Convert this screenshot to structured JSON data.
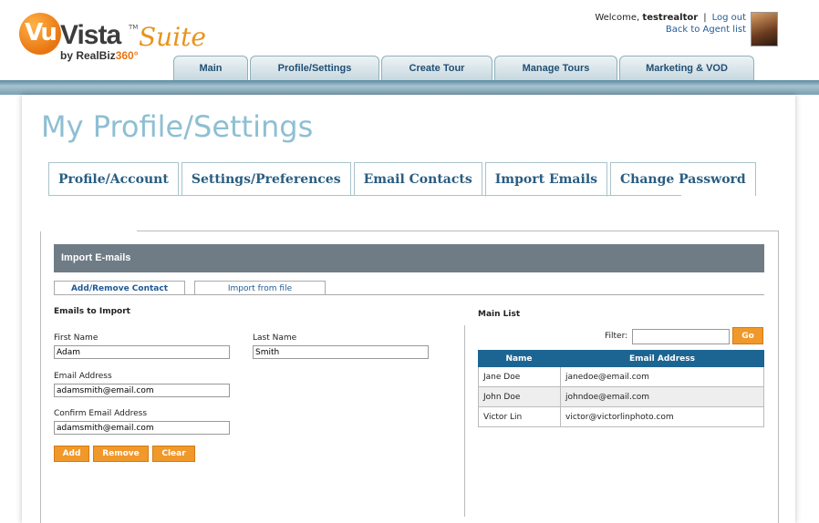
{
  "logo": {
    "mark": "Vu",
    "name": "Vista",
    "tm": "TM",
    "suite": "Suite",
    "by": "by RealBiz",
    "by_num": "360",
    "by_degree": "°"
  },
  "header": {
    "welcome_prefix": "Welcome,",
    "username": "testrealtor",
    "separator": "|",
    "logout": "Log out",
    "back_link": "Back to Agent list"
  },
  "top_nav": [
    "Main",
    "Profile/Settings",
    "Create Tour",
    "Manage Tours",
    "Marketing & VOD"
  ],
  "page_title": "My Profile/Settings",
  "sub_tabs": [
    "Profile/Account",
    "Settings/Preferences",
    "Email Contacts",
    "Import Emails",
    "Change Password"
  ],
  "active_sub_tab": "Import Emails",
  "panel": {
    "heading": "Import E-mails",
    "inner_tabs": [
      "Add/Remove Contact",
      "Import from file"
    ],
    "form": {
      "section_title": "Emails to Import",
      "first_name_label": "First Name",
      "first_name_value": "Adam",
      "last_name_label": "Last Name",
      "last_name_value": "Smith",
      "email_label": "Email Address",
      "email_value": "adamsmith@email.com",
      "confirm_label": "Confirm Email Address",
      "confirm_value": "adamsmith@email.com",
      "buttons": {
        "add": "Add",
        "remove": "Remove",
        "clear": "Clear"
      }
    },
    "main_list": {
      "title": "Main List",
      "filter_label": "Filter:",
      "filter_value": "",
      "go": "Go",
      "columns": [
        "Name",
        "Email Address"
      ],
      "rows": [
        {
          "name": "Jane Doe",
          "email": "janedoe@email.com"
        },
        {
          "name": "John Doe",
          "email": "johndoe@email.com"
        },
        {
          "name": "Victor Lin",
          "email": "victor@victorlinphoto.com"
        }
      ]
    }
  },
  "colors": {
    "accent_orange": "#f0982a",
    "table_header": "#1c6592",
    "title_blue": "#8ebfd3",
    "panel_header": "#6f7c86"
  }
}
